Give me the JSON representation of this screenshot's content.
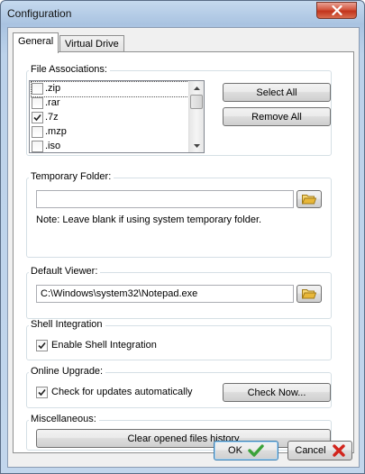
{
  "window": {
    "title": "Configuration"
  },
  "tabs": [
    {
      "label": "General",
      "active": true
    },
    {
      "label": "Virtual Drive",
      "active": false
    }
  ],
  "file_associations": {
    "label": "File Associations:",
    "items": [
      {
        "ext": ".zip",
        "checked": false
      },
      {
        "ext": ".rar",
        "checked": false
      },
      {
        "ext": ".7z",
        "checked": true
      },
      {
        "ext": ".mzp",
        "checked": false
      },
      {
        "ext": ".iso",
        "checked": false
      }
    ],
    "select_all": "Select All",
    "remove_all": "Remove All"
  },
  "temp_folder": {
    "label": "Temporary Folder:",
    "value": "",
    "note": "Note: Leave blank if using system temporary folder."
  },
  "default_viewer": {
    "label": "Default Viewer:",
    "value": "C:\\Windows\\system32\\Notepad.exe"
  },
  "shell_integration": {
    "label": "Shell Integration",
    "option": "Enable Shell Integration",
    "checked": true
  },
  "online_upgrade": {
    "label": "Online Upgrade:",
    "option": "Check for updates automatically",
    "checked": true,
    "check_now": "Check Now..."
  },
  "misc": {
    "label": "Miscellaneous:",
    "clear_history": "Clear opened files history"
  },
  "footer": {
    "ok": "OK",
    "cancel": "Cancel"
  },
  "colors": {
    "ok_check": "#3aa23a",
    "cancel_x": "#d2241c",
    "folder": "#e8b739"
  }
}
